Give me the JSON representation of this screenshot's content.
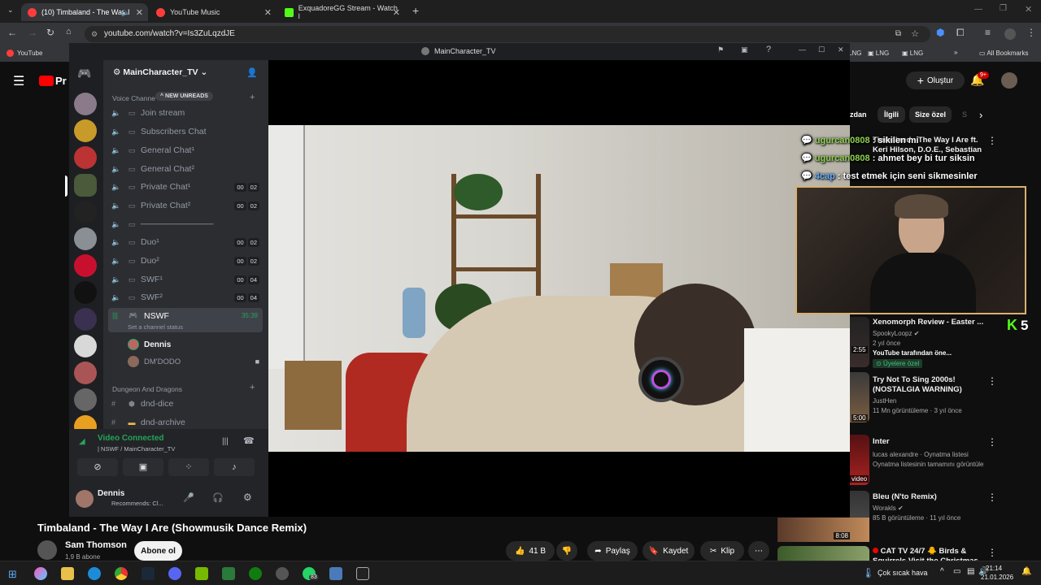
{
  "browser": {
    "tabs": [
      {
        "label": "(10) Timbaland - The Way I",
        "color": "#ff3d3d"
      },
      {
        "label": "YouTube Music",
        "color": "#ff3d3d"
      },
      {
        "label": "ExquadoreGG Stream - Watch l",
        "color": "#53fc18"
      }
    ],
    "url": "youtube.com/watch?v=Is3ZuLqzdJE",
    "bookmarks": {
      "first": "YouTube",
      "lng1": "LNG",
      "lng2": "LNG",
      "all": "All Bookmarks"
    }
  },
  "youtube": {
    "logo": "Pr",
    "create_label": "Oluştur",
    "notif_count": "9+",
    "chips": [
      "zdan",
      "İlgili",
      "Size özel",
      "S"
    ],
    "video_title": "Timbaland - The Way I Are (Showmusik Dance Remix)",
    "channel_name": "Sam Thomson",
    "subscribers": "1,9 B abone",
    "subscribe_label": "Abone ol",
    "likes": "41 B",
    "share_label": "Paylaş",
    "save_label": "Kaydet",
    "clip_label": "Klip",
    "recs": [
      {
        "title": "Timbaland - The Way I Are ft. Keri Hilson, D.O.E., Sebastian",
        "meta1": "",
        "meta2": ""
      },
      {
        "title": "Xenomorph Review - Easter ...",
        "meta1": "SpookyLoopz",
        "meta2": "2 yıl önce",
        "meta3": "YouTube tarafından öne...",
        "badge": "Üyelere özel",
        "duration": "2:55"
      },
      {
        "title": "Try Not To Sing 2000s! (NOSTALGIA WARNING)",
        "meta1": "JustHen",
        "meta2": "11 Mn görüntüleme · 3 yıl önce",
        "duration": "5:00"
      },
      {
        "title": "Inter",
        "meta1": "lucas alexandre · Oynatma listesi",
        "meta2": "Oynatma listesinin tamamını görüntüle",
        "duration": "video"
      },
      {
        "title": "Bleu (N'to Remix)",
        "meta1": "Worakls",
        "meta2": "85 B görüntüleme · 11 yıl önce"
      },
      {
        "title": "CAT TV 24/7 🐥 Birds & Squirrels Visit the Christmas",
        "meta1": "",
        "meta2": ""
      }
    ],
    "mini_duration": "8:08"
  },
  "discord": {
    "window_title": "MainCharacter_TV",
    "server_name": "MainCharacter_TV",
    "voice_category": "Voice Channe",
    "new_unreads": "NEW UNREADS",
    "channels": [
      {
        "name": "Join stream",
        "cnt": null
      },
      {
        "name": "Subscribers Chat",
        "cnt": null
      },
      {
        "name": "General Chat¹",
        "cnt": null
      },
      {
        "name": "General Chat²",
        "cnt": null
      },
      {
        "name": "Private Chat¹",
        "cnt": [
          "00",
          "02"
        ]
      },
      {
        "name": "Private Chat²",
        "cnt": [
          "00",
          "02"
        ]
      },
      {
        "name": "────────────",
        "cnt": null
      },
      {
        "name": "Duo¹",
        "cnt": [
          "00",
          "02"
        ]
      },
      {
        "name": "Duo²",
        "cnt": [
          "00",
          "02"
        ]
      },
      {
        "name": "SWF¹",
        "cnt": [
          "00",
          "04"
        ]
      },
      {
        "name": "SWF²",
        "cnt": [
          "00",
          "04"
        ]
      }
    ],
    "active_channel": {
      "name": "NSWF",
      "timer": "35:39",
      "status": "Set a channel status"
    },
    "members": [
      "Dennis",
      "DM'DODO"
    ],
    "dnd_category": "Dungeon And Dragons",
    "dnd_channels": [
      "dnd-dice",
      "dnd-archive"
    ],
    "voice_status": "Video Connected",
    "voice_sub": "NSWF / MainCharacter_TV",
    "user_name": "Dennis",
    "user_status": "Recommends: Cl..."
  },
  "stream": {
    "chat": [
      {
        "user": "ugurcan0808",
        "msg": " : sikilen mi"
      },
      {
        "user": "ugurcan0808",
        "msg": " : ahmet bey bi tur siksin"
      },
      {
        "user": "4cap",
        "msg": " : test etmek için seni sikmesinler"
      }
    ],
    "kick_count": "5"
  },
  "taskbar": {
    "whatsapp_badge": "83",
    "weather": "Çok sıcak hava",
    "time": "21:14",
    "date": "21.01.2026"
  }
}
